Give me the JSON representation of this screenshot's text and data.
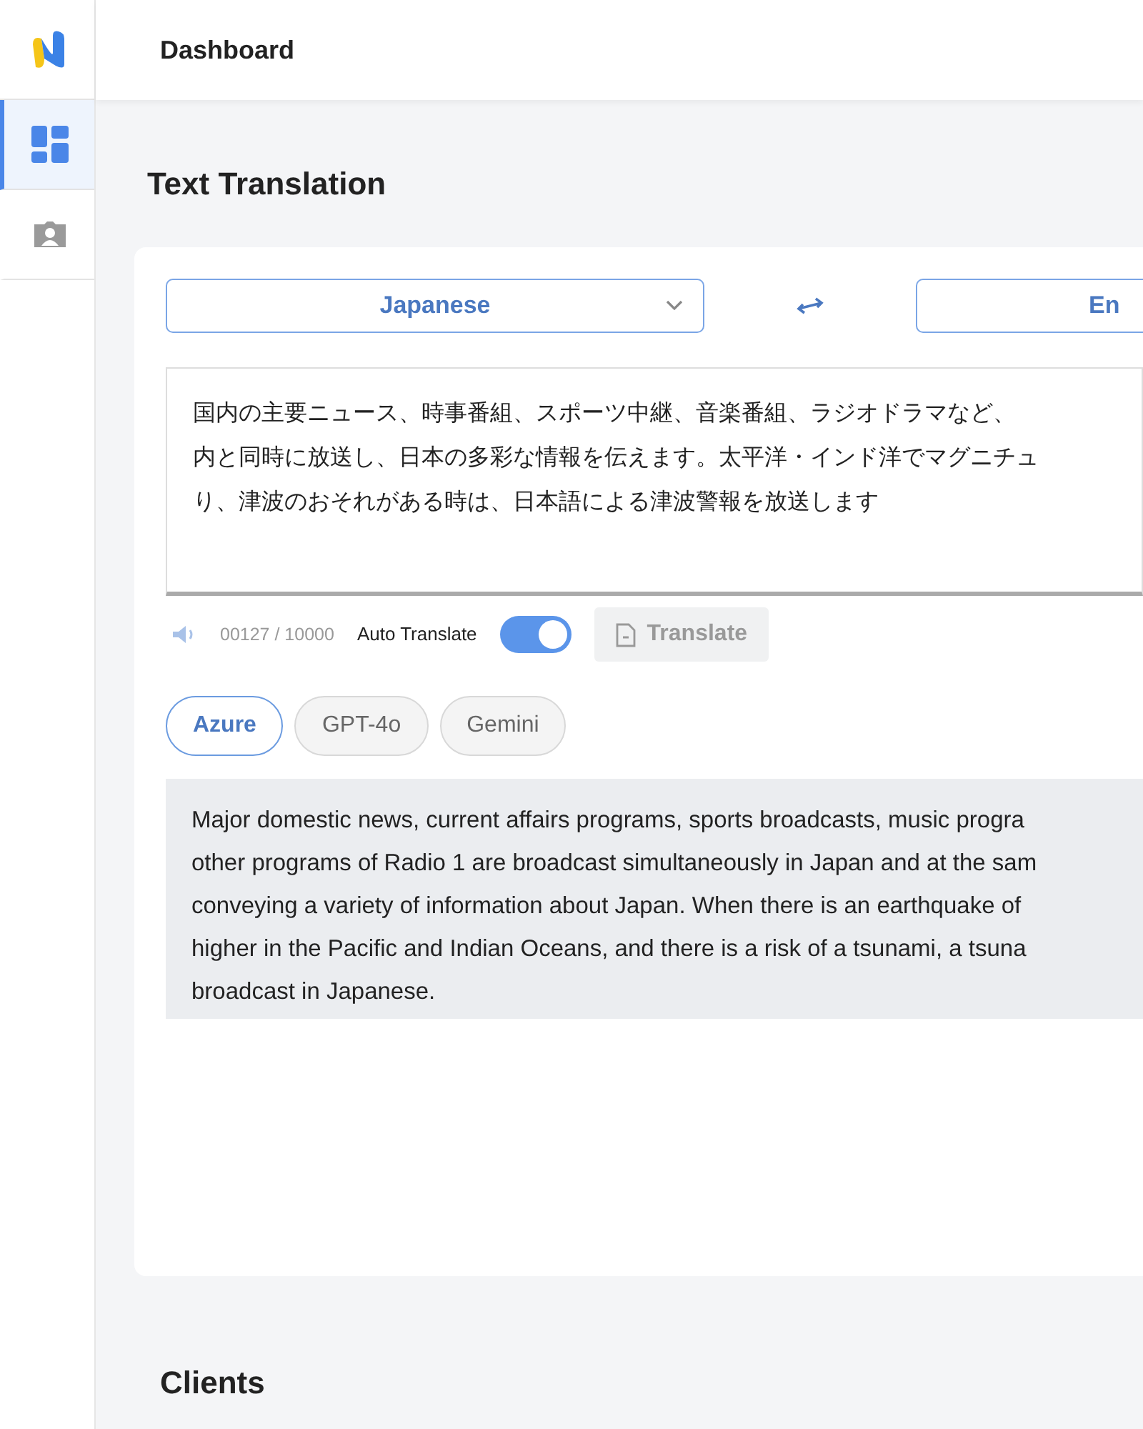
{
  "header": {
    "title": "Dashboard"
  },
  "sidebar": {
    "items": [
      {
        "kind": "dashboard",
        "selected": true
      },
      {
        "kind": "contacts",
        "selected": false
      }
    ]
  },
  "page_title": "Text Translation",
  "translator": {
    "source_language": "Japanese",
    "target_language": "En",
    "input_lines": [
      "国内の主要ニュース、時事番組、スポーツ中継、音楽番組、ラジオドラマなど、",
      "内と同時に放送し、日本の多彩な情報を伝えます。太平洋・インド洋でマグニチュ",
      "り、津波のおそれがある時は、日本語による津波警報を放送します"
    ],
    "char_count": "00127 / 10000",
    "auto_translate": {
      "label": "Auto Translate",
      "on": true
    },
    "translate_button": {
      "label": "Translate",
      "disabled": true
    },
    "engines": [
      {
        "label": "Azure",
        "selected": true
      },
      {
        "label": "GPT-4o",
        "selected": false
      },
      {
        "label": "Gemini",
        "selected": false
      }
    ],
    "output_lines": [
      "Major domestic news, current affairs programs, sports broadcasts, music progra",
      "other programs of Radio 1 are broadcast simultaneously in Japan and at the sam",
      "conveying a variety of information about Japan. When there is an earthquake of",
      "higher in the Pacific and Indian Oceans, and there is a risk of a tsunami, a tsuna",
      "broadcast in Japanese."
    ]
  },
  "section_title": "Clients"
}
